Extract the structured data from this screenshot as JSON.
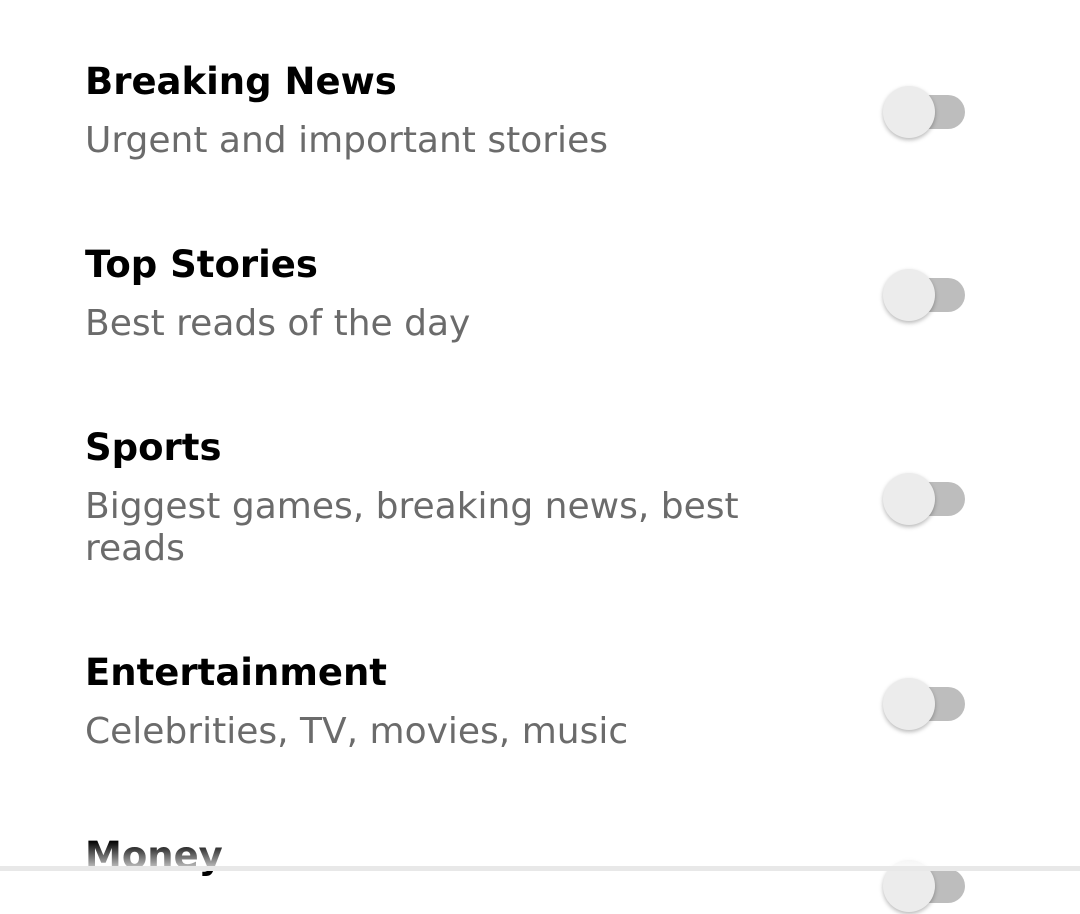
{
  "settings": {
    "items": [
      {
        "title": "Breaking News",
        "subtitle": "Urgent and important stories",
        "enabled": false
      },
      {
        "title": "Top Stories",
        "subtitle": "Best reads of the day",
        "enabled": false
      },
      {
        "title": "Sports",
        "subtitle": "Biggest games, breaking news, best reads",
        "enabled": false
      },
      {
        "title": "Entertainment",
        "subtitle": "Celebrities, TV, movies, music",
        "enabled": false
      },
      {
        "title": "Money",
        "subtitle": "",
        "enabled": false
      }
    ]
  },
  "colors": {
    "title": "#000000",
    "subtitle": "#6b6b6b",
    "toggle_track_off": "#bdbdbd",
    "toggle_thumb_off": "#ececec"
  }
}
